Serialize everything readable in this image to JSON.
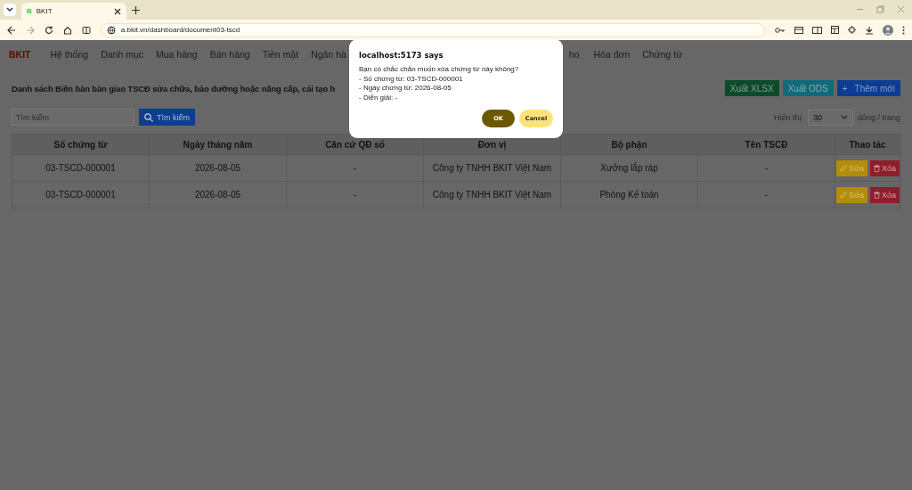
{
  "browser": {
    "tab_title": "BKIT",
    "tab_favicon": "B",
    "url": "a.bkit.vn/dashboard/document03-tscd"
  },
  "nav": {
    "brand": "BKIT",
    "items": [
      "Hệ thống",
      "Danh mục",
      "Mua hàng",
      "Bán hàng",
      "Tiền mặt",
      "Ngân hà",
      "ho",
      "Hóa đơn",
      "Chứng từ"
    ]
  },
  "heading": "Danh sách Biên bản bàn giao TSCĐ sửa chữa, bảo dưỡng hoặc nâng cấp, cải tạo h",
  "actions": [
    {
      "label": "Xuất XLSX",
      "kind": "xlsx"
    },
    {
      "label": "Xuất ODS",
      "kind": "ods"
    },
    {
      "label": "Thêm mới",
      "kind": "add",
      "icon": "+"
    }
  ],
  "search": {
    "placeholder": "Tìm kiếm",
    "button": "Tìm kiếm"
  },
  "page_size": {
    "label": "Hiển thị:",
    "value": "30",
    "suffix": "dòng / trang"
  },
  "table": {
    "columns": [
      "Số chứng từ",
      "Ngày tháng năm",
      "Căn cứ QĐ số",
      "Đơn vị",
      "Bộ phận",
      "Tên TSCĐ",
      "Thao tác"
    ],
    "rows": [
      {
        "cells": [
          "03-TSCD-000001",
          "2026-08-05",
          "-",
          "Công ty TNHH BKIT Việt Nam",
          "Xưởng lắp ráp",
          "-"
        ],
        "edit": "Sửa",
        "delete": "Xóa"
      },
      {
        "cells": [
          "03-TSCD-000001",
          "2026-08-05",
          "-",
          "Công ty TNHH BKIT Việt Nam",
          "Phòng Kế toán",
          "-"
        ],
        "edit": "Sửa",
        "delete": "Xóa"
      }
    ]
  },
  "dialog": {
    "title": "localhost:5173 says",
    "lines": [
      "Bạn có chắc chắn muốn xóa chứng từ này không?",
      "- Số chứng từ: 03-TSCD-000001",
      "- Ngày chứng từ: 2026-08-05",
      "- Diễn giải: -"
    ],
    "buttons": [
      {
        "label": "OK",
        "kind": "primary"
      },
      {
        "label": "Cancel",
        "kind": "secondary"
      }
    ]
  }
}
